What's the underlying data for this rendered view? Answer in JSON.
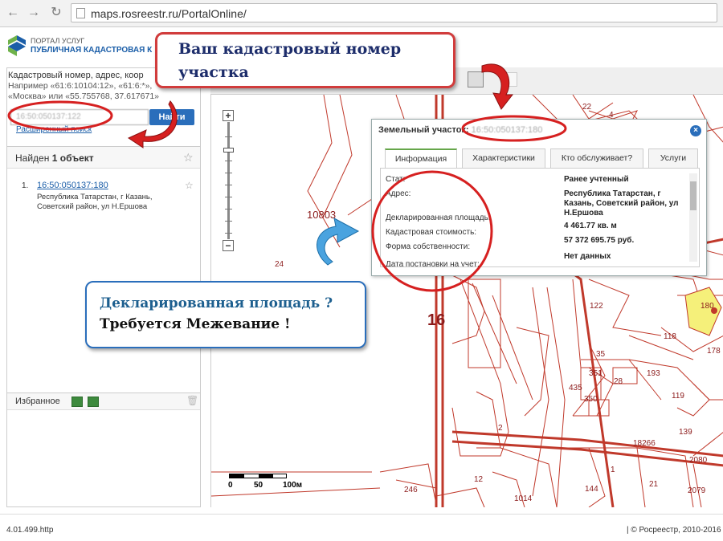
{
  "browser": {
    "url": "maps.rosreestr.ru/PortalOnline/"
  },
  "portal": {
    "title": "ПОРТАЛ УСЛУГ",
    "subtitle": "ПУБЛИЧНАЯ КАДАСТРОВАЯ К"
  },
  "search": {
    "hint_line1": "Кадастровый номер, адрес, коор",
    "hint_line2": "Например «61:6:10104:12», «61:6:*»,",
    "hint_line3": "«Москва» или «55.755768, 37.617671»",
    "input_value": "16:50:050137:122",
    "button_label": "Найти",
    "advanced_link": "Расширенный поиск"
  },
  "results": {
    "found_prefix": "Найден",
    "found_count": "1",
    "found_suffix": "объект",
    "items": [
      {
        "num": "1.",
        "cadastral": "16:50:050137:180",
        "address": "Республика Татарстан, г Казань, Советский район, ул Н.Ершова"
      }
    ]
  },
  "favorites": {
    "label": "Избранное"
  },
  "popup": {
    "title_prefix": "Земельный участок:",
    "title_value": "16:50:050137:180",
    "tabs": [
      "Информация",
      "Характеристики",
      "Кто обслуживает?",
      "Услуги"
    ],
    "rows": [
      {
        "label": "Стат:",
        "value": "Ранее учтенный"
      },
      {
        "label": "Адрес:",
        "value": "Республика Татарстан, г Казань, Советский район, ул Н.Ершова"
      },
      {
        "label": "Декларированная площадь:",
        "value": "4 461.77 кв. м"
      },
      {
        "label": "Кадастровая стоимость:",
        "value": "57 372 695.75 руб."
      },
      {
        "label": "Форма собственности:",
        "value": "Нет данных"
      },
      {
        "label": "Дата постановки на учет:",
        "value": ""
      }
    ]
  },
  "callouts": {
    "top_line1": "Ваш кадастровый номер",
    "top_line2": "участка",
    "bottom_line1": "Декларированная площадь ?",
    "bottom_line2": "Требуется Межевание !"
  },
  "map": {
    "labels": [
      "10803",
      "24",
      "16",
      "22",
      "4",
      "122",
      "35",
      "351",
      "28",
      "193",
      "435",
      "350",
      "119",
      "178",
      "118",
      "18266",
      "139",
      "2",
      "1",
      "21",
      "144",
      "246",
      "12",
      "1014",
      "2080",
      "2079",
      "180"
    ],
    "scale": {
      "l0": "0",
      "l50": "50",
      "l100": "100м"
    }
  },
  "status": {
    "left": "4.01.499.http",
    "right": "| © Росреестр, 2010-2016"
  },
  "colors": {
    "accent": "#2a6ebb",
    "callout_red": "#d13c3c",
    "parcel_line": "#c0392b",
    "selected_parcel": "#f5f07a"
  }
}
